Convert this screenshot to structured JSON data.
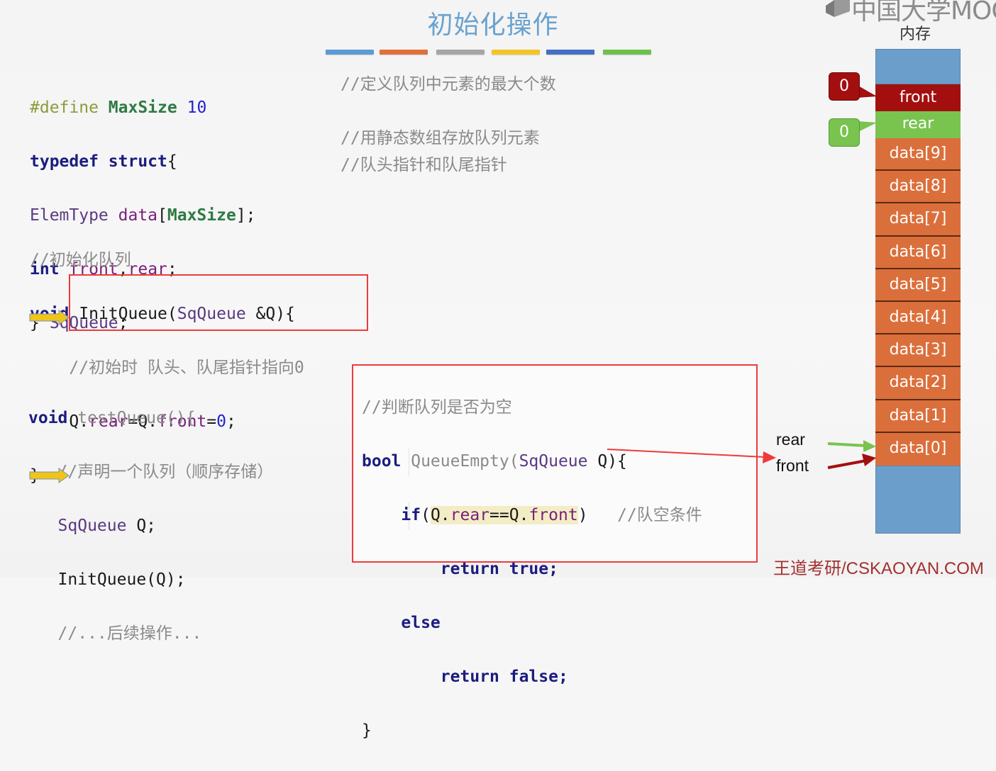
{
  "slide": {
    "title": "初始化操作",
    "title_bar_colors": [
      "#5b9bd5",
      "#e0703a",
      "#a5a5a5",
      "#f2c428",
      "#4470c4",
      "#6fbf4b"
    ],
    "logo_text": "中国大学MOOC",
    "watermark": "王道考研/CSKAOYAN.COM"
  },
  "code_struct": {
    "line1": {
      "pp": "#define",
      "name": "MaxSize",
      "value": "10"
    },
    "line2": {
      "kw1": "typedef",
      "kw2": "struct",
      "brace": "{"
    },
    "line3": {
      "type": "ElemType",
      "field": "data",
      "open": "[",
      "const": "MaxSize",
      "close": "];"
    },
    "line4": {
      "kw": "int",
      "f1": "front",
      "comma": ",",
      "f2": "rear",
      "semi": ";"
    },
    "line5": {
      "brace": "}",
      "type": "SqQueue",
      "semi": ";"
    },
    "comments": [
      "//定义队列中元素的最大个数",
      "//用静态数组存放队列元素",
      "//队头指针和队尾指针"
    ]
  },
  "code_init": {
    "comment": "//初始化队列",
    "sig_kw": "void",
    "sig_name": "InitQueue(",
    "sig_type": "SqQueue",
    "sig_rest": " &Q){",
    "inner_comment": "//初始时 队头、队尾指针指向0",
    "stmt_q1": "Q.",
    "stmt_rear": "rear",
    "stmt_eq": "=Q.",
    "stmt_front": "front",
    "stmt_eq2": "=",
    "stmt_zero": "0",
    "stmt_semi": ";",
    "close": "}"
  },
  "code_test": {
    "sig_kw": "void",
    "sig_name": " testQueue(){",
    "comment": "//声明一个队列（顺序存储）",
    "decl_type": "SqQueue",
    "decl_rest": " Q;",
    "call": "InitQueue(Q);",
    "tail_comment": "//...后续操作..."
  },
  "code_empty": {
    "comment": "//判断队列是否为空",
    "sig_kw": "bool",
    "sig_name": " QueueEmpty(",
    "sig_type": "SqQueue",
    "sig_rest": " Q){",
    "if_kw": "if",
    "if_open": "(",
    "cond_q1": "Q.",
    "cond_rear": "rear",
    "cond_eq": "==Q.",
    "cond_front": "front",
    "if_close": ")",
    "if_comment": "//队空条件",
    "ret_kw": "return",
    "ret_true": "true",
    "semi": ";",
    "else_kw": "else",
    "ret_false": "false",
    "close": "}"
  },
  "memory": {
    "label": "内存",
    "front_label": "front",
    "rear_label": "rear",
    "front_value": "0",
    "rear_value": "0",
    "cells": [
      "data[9]",
      "data[8]",
      "data[7]",
      "data[6]",
      "data[5]",
      "data[4]",
      "data[3]",
      "data[2]",
      "data[1]",
      "data[0]"
    ],
    "pointer_rear": "rear",
    "pointer_front": "front",
    "colors": {
      "front": "#a30f0f",
      "rear": "#79c44f",
      "data": "#db6f3b",
      "empty": "#6b9ecb"
    }
  }
}
